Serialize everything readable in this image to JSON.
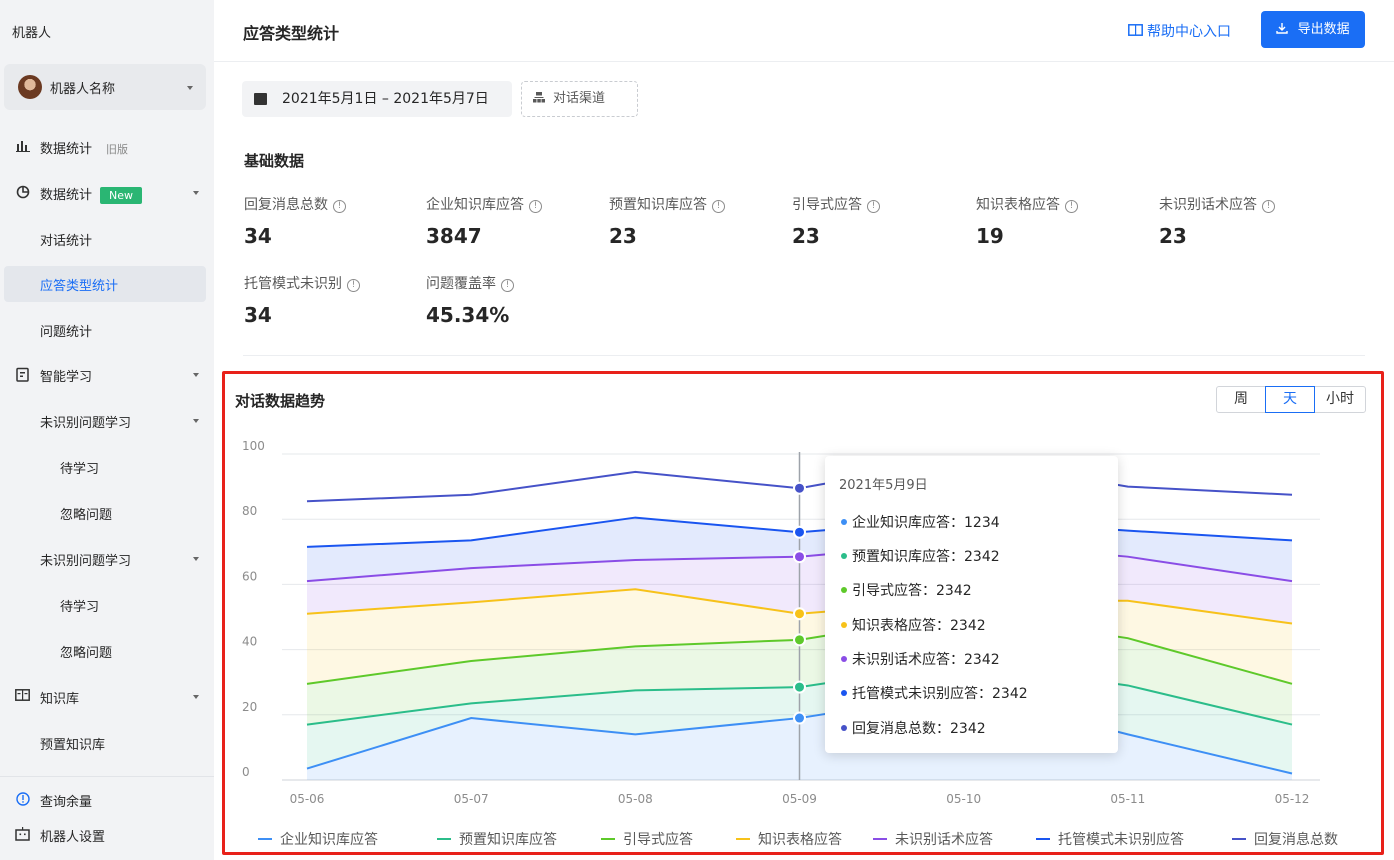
{
  "sidebar": {
    "title": "机器人",
    "bot_name": "机器人名称",
    "items": [
      {
        "icon": "bar-chart-icon",
        "label": "数据统计",
        "tag_old": "旧版"
      },
      {
        "icon": "pie-chart-icon",
        "label": "数据统计",
        "tag_new": "New"
      },
      {
        "label": "对话统计"
      },
      {
        "label": "应答类型统计"
      },
      {
        "label": "问题统计"
      },
      {
        "icon": "clipboard-icon",
        "label": "智能学习"
      },
      {
        "label": "未识别问题学习"
      },
      {
        "label": "待学习"
      },
      {
        "label": "忽略问题"
      },
      {
        "label": "未识别问题学习"
      },
      {
        "label": "待学习"
      },
      {
        "label": "忽略问题"
      },
      {
        "icon": "book-icon",
        "label": "知识库"
      },
      {
        "label": "预置知识库"
      },
      {
        "icon": "info-circle-icon",
        "label": "查询余量"
      },
      {
        "icon": "robot-settings-icon",
        "label": "机器人设置"
      }
    ]
  },
  "header": {
    "title": "应答类型统计",
    "help_label": "帮助中心入口",
    "export_label": "导出数据"
  },
  "filters": {
    "date_range": "2021年5月1日 – 2021年5月7日",
    "channel_label": "对话渠道"
  },
  "basic": {
    "title": "基础数据",
    "stats": [
      {
        "label": "回复消息总数",
        "value": "34"
      },
      {
        "label": "企业知识库应答",
        "value": "3847"
      },
      {
        "label": "预置知识库应答",
        "value": "23"
      },
      {
        "label": "引导式应答",
        "value": "23"
      },
      {
        "label": "知识表格应答",
        "value": "19"
      },
      {
        "label": "未识别话术应答",
        "value": "23"
      },
      {
        "label": "托管模式未识别",
        "value": "34"
      },
      {
        "label": "问题覆盖率",
        "value": "45.34%"
      }
    ]
  },
  "trend": {
    "title": "对话数据趋势",
    "ranges": [
      "周",
      "天",
      "小时"
    ],
    "active_range": "天"
  },
  "tooltip": {
    "date": "2021年5月9日",
    "rows": [
      {
        "label": "企业知识库应答：1234",
        "color": "#3d8ff5"
      },
      {
        "label": "预置知识库应答：2342",
        "color": "#2bbd8a"
      },
      {
        "label": "引导式应答：2342",
        "color": "#5ec92a"
      },
      {
        "label": "知识表格应答：2342",
        "color": "#f7c21a"
      },
      {
        "label": "未识别话术应答：2342",
        "color": "#8a4de6"
      },
      {
        "label": "托管模式未识别应答：2342",
        "color": "#1a55f0"
      },
      {
        "label": "回复消息总数：2342",
        "color": "#4652c8"
      }
    ]
  },
  "chart_data": {
    "type": "area",
    "categories": [
      "05-06",
      "05-07",
      "05-08",
      "05-09",
      "05-10",
      "05-11",
      "05-12"
    ],
    "ylim": [
      0,
      100
    ],
    "yticks": [
      0,
      20,
      40,
      60,
      80,
      100
    ],
    "series": [
      {
        "name": "企业知识库应答",
        "color": "#3d8ff5",
        "values": [
          3.5,
          19,
          14,
          19,
          27,
          14,
          2
        ]
      },
      {
        "name": "预置知识库应答",
        "color": "#2bbd8a",
        "values": [
          17,
          23.5,
          27.5,
          28.5,
          36,
          29,
          17
        ]
      },
      {
        "name": "引导式应答",
        "color": "#5ec92a",
        "values": [
          29.5,
          36.5,
          41,
          43,
          51,
          43.5,
          29.5
        ]
      },
      {
        "name": "知识表格应答",
        "color": "#f7c21a",
        "values": [
          51,
          54.5,
          58.5,
          51,
          55,
          55,
          48
        ]
      },
      {
        "name": "未识别话术应答",
        "color": "#8a4de6",
        "values": [
          61,
          65,
          67.5,
          68.5,
          73,
          68.5,
          61
        ]
      },
      {
        "name": "托管模式未识别应答",
        "color": "#1a55f0",
        "values": [
          71.5,
          73.5,
          80.5,
          76,
          80,
          76.5,
          73.5
        ]
      },
      {
        "name": "回复消息总数",
        "color": "#4652c8",
        "values": [
          85.5,
          87.5,
          94.5,
          89.5,
          98.5,
          90,
          87.5
        ]
      }
    ]
  }
}
